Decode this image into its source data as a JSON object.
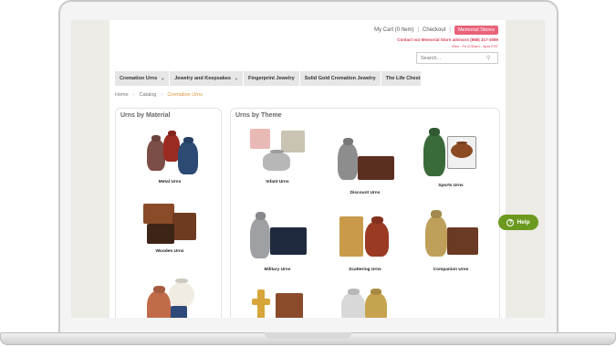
{
  "header": {
    "cart": "My Cart (0 Item)",
    "checkout": "Checkout",
    "memorial_stores": "Memorial Stores",
    "contact": "Contact our Memorial Store advisors (888) 317-3089",
    "hours": "Mon - Fri 8:30am - 6pm EST",
    "search_placeholder": "Search...",
    "separator": "|"
  },
  "nav": {
    "items": [
      {
        "label": "Cremation Urns",
        "caret": "▼"
      },
      {
        "label": "Jewelry and Keepsakes",
        "caret": "▼"
      },
      {
        "label": "Fingerprint Jewelry"
      },
      {
        "label": "Solid Gold Cremation Jewelry"
      },
      {
        "label": "The Life Chest"
      }
    ]
  },
  "breadcrumb": {
    "items": [
      "Home",
      "Catalog",
      "Cremation Urns"
    ],
    "chevron": "›"
  },
  "material": {
    "title": "Urns by Material",
    "tiles": [
      "Metal Urns",
      "Wooden Urns",
      ""
    ]
  },
  "theme": {
    "title": "Urns by Theme",
    "tiles": [
      "Infant Urns",
      "Discount Urns",
      "Sports Urns",
      "Military Urns",
      "Scattering Urns",
      "Companion Urns",
      "",
      ""
    ]
  },
  "help": {
    "label": "Help",
    "icon": "?"
  },
  "colors": {
    "accent": "#e8637a",
    "help": "#6c9a1f",
    "active_crumb": "#d9933a"
  }
}
